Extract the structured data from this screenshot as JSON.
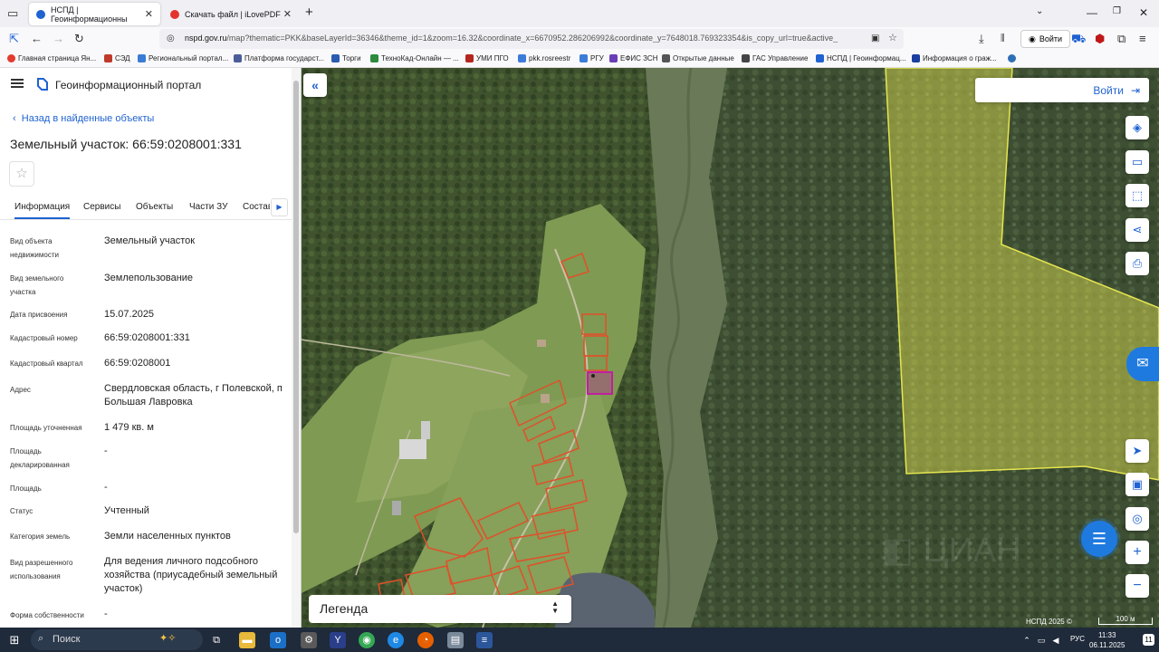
{
  "browser": {
    "tabs": [
      {
        "label": "НСПД | Геоинформационны",
        "active": true
      },
      {
        "label": "Скачать файл | iLovePDF",
        "active": false
      }
    ],
    "url_host": "nspd.gov.ru",
    "url_rest": "/map?thematic=PKK&baseLayerId=36346&theme_id=1&zoom=16.32&coordinate_x=6670952.286206992&coordinate_y=7648018.769323354&is_copy_url=true&active_",
    "login_label": "Войти"
  },
  "bookmarks": [
    "Главная страница Ян...",
    "СЭД",
    "Региональный портал...",
    "Платформа государст...",
    "Торги",
    "ТехноКад-Онлайн — ...",
    "УМИ ПГО",
    "pkk.rosreestr",
    "РГУ",
    "ЕФИС ЗСН",
    "Открытые данные",
    "ГАС Управление",
    "НСПД | Геоинформац...",
    "Информация о граж..."
  ],
  "panel": {
    "portal_title": "Геоинформационный портал",
    "back_link": "Назад в найденные объекты",
    "object_title": "Земельный участок: 66:59:0208001:331",
    "tabs": [
      "Информация",
      "Сервисы",
      "Объекты",
      "Части ЗУ",
      "Состав"
    ],
    "fields": [
      {
        "label": "Вид объекта недвижимости",
        "value": "Земельный участок"
      },
      {
        "label": "Вид земельного участка",
        "value": "Землепользование"
      },
      {
        "label": "Дата присвоения",
        "value": "15.07.2025"
      },
      {
        "label": "Кадастровый номер",
        "value": "66:59:0208001:331"
      },
      {
        "label": "Кадастровый квартал",
        "value": "66:59:0208001"
      },
      {
        "label": "Адрес",
        "value": "Свердловская область, г Полевской, п Большая Лавровка"
      },
      {
        "label": "Площадь уточненная",
        "value": "1 479 кв. м"
      },
      {
        "label": "Площадь декларированная",
        "value": "-"
      },
      {
        "label": "Площадь",
        "value": "-"
      },
      {
        "label": "Статус",
        "value": "Учтенный"
      },
      {
        "label": "Категория земель",
        "value": "Земли населенных пунктов"
      },
      {
        "label": "Вид разрешенного использования",
        "value": "Для ведения личного подсобного хозяйства (приусадебный земельный участок)"
      },
      {
        "label": "Форма собственности",
        "value": "-"
      }
    ]
  },
  "map": {
    "login_label": "Войти",
    "legend_label": "Легенда",
    "copyright": "НСПД 2025 ©",
    "scale_label": "100 м",
    "colors": {
      "parcel_outline": "#e0502a",
      "selected_parcel": "#c020a0",
      "forest_zone": "#e6e650",
      "accent": "#1f62d1"
    }
  },
  "taskbar": {
    "search_label": "Поиск",
    "language": "РУС",
    "time": "11:33",
    "date": "06.11.2025",
    "notifications": "11"
  }
}
